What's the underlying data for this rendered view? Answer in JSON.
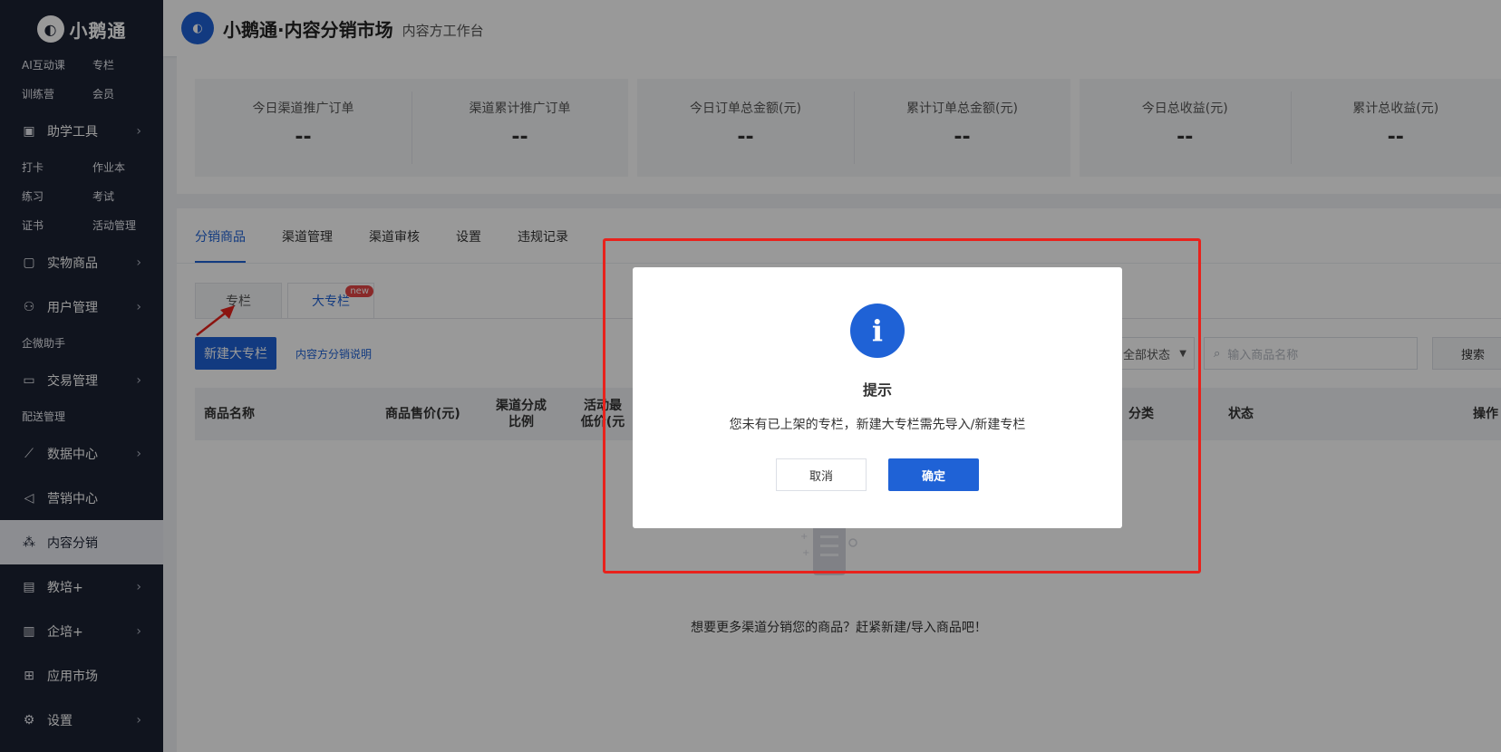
{
  "brand": {
    "logo_text": "小鹅通",
    "top_title": "小鹅通·内容分销市场",
    "top_sub": "内容方工作台"
  },
  "sidebar": {
    "top_items": [
      "AI互动课",
      "专栏",
      "训练营",
      "会员"
    ],
    "menus": [
      {
        "label": "助学工具",
        "icon": "briefcase-icon",
        "sub": [
          "打卡",
          "作业本",
          "练习",
          "考试",
          "证书",
          "活动管理"
        ]
      },
      {
        "label": "实物商品",
        "icon": "bag-icon",
        "sub": []
      },
      {
        "label": "用户管理",
        "icon": "user-icon",
        "sub": [
          "企微助手"
        ]
      },
      {
        "label": "交易管理",
        "icon": "card-icon",
        "sub": [
          "配送管理"
        ]
      },
      {
        "label": "数据中心",
        "icon": "chart-icon",
        "sub": []
      },
      {
        "label": "营销中心",
        "icon": "megaphone-icon",
        "sub": []
      },
      {
        "label": "内容分销",
        "icon": "org-icon",
        "sub": []
      },
      {
        "label": "教培+",
        "icon": "board-icon",
        "sub": []
      },
      {
        "label": "企培+",
        "icon": "badge-icon",
        "sub": []
      },
      {
        "label": "应用市场",
        "icon": "grid-icon",
        "sub": []
      },
      {
        "label": "设置",
        "icon": "gear-icon",
        "sub": []
      }
    ]
  },
  "stats": [
    {
      "label": "今日渠道推广订单",
      "value": "--"
    },
    {
      "label": "渠道累计推广订单",
      "value": "--"
    },
    {
      "label": "今日订单总金额(元)",
      "value": "--"
    },
    {
      "label": "累计订单总金额(元)",
      "value": "--"
    },
    {
      "label": "今日总收益(元)",
      "value": "--"
    },
    {
      "label": "累计总收益(元)",
      "value": "--"
    }
  ],
  "tabs": [
    "分销商品",
    "渠道管理",
    "渠道审核",
    "设置",
    "违规记录"
  ],
  "subtabs": {
    "column": "专栏",
    "big_column": "大专栏",
    "new_badge": "new"
  },
  "toolbar": {
    "new_button": "新建大专栏",
    "help_link": "内容方分销说明",
    "status_select": "全部状态",
    "search_placeholder": "输入商品名称",
    "search_button": "搜索"
  },
  "table": {
    "headers": [
      "商品名称",
      "商品售价(元)",
      "渠道分成\n比例",
      "活动最\n低价(元",
      "分类",
      "状态",
      "操作"
    ]
  },
  "empty_text": "想要更多渠道分销您的商品？赶紧新建/导入商品吧！",
  "dialog": {
    "title": "提示",
    "message": "您未有已上架的专栏，新建大专栏需先导入/新建专栏",
    "cancel": "取消",
    "ok": "确定"
  },
  "colors": {
    "accent": "#1f62d6",
    "sidebar_bg": "#1c2233",
    "highlight": "#e8221c"
  }
}
